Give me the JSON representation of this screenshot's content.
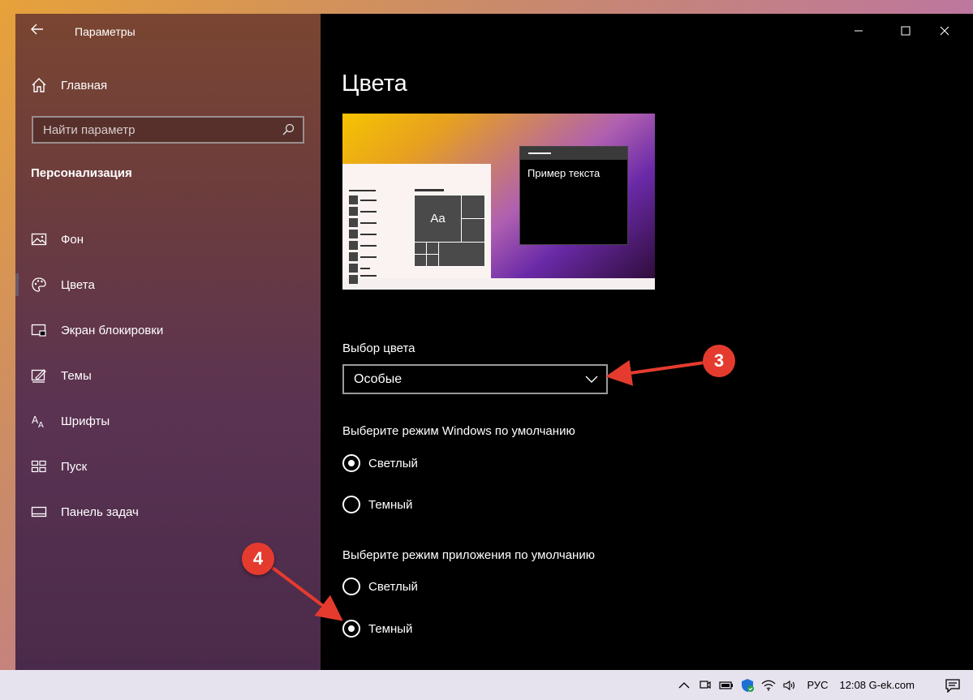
{
  "window": {
    "app_title": "Параметры",
    "controls": {
      "minimize": "minimize-icon",
      "maximize": "maximize-icon",
      "close": "close-icon"
    }
  },
  "sidebar": {
    "home_label": "Главная",
    "search_placeholder": "Найти параметр",
    "section_title": "Персонализация",
    "items": [
      {
        "label": "Фон",
        "icon": "picture-icon",
        "active": false
      },
      {
        "label": "Цвета",
        "icon": "palette-icon",
        "active": true
      },
      {
        "label": "Экран блокировки",
        "icon": "lock-screen-icon",
        "active": false
      },
      {
        "label": "Темы",
        "icon": "themes-icon",
        "active": false
      },
      {
        "label": "Шрифты",
        "icon": "fonts-icon",
        "active": false
      },
      {
        "label": "Пуск",
        "icon": "start-icon",
        "active": false
      },
      {
        "label": "Панель задач",
        "icon": "taskbar-icon",
        "active": false
      }
    ]
  },
  "main": {
    "page_title": "Цвета",
    "preview": {
      "sample_text": "Пример текста",
      "tile_text": "Aa"
    },
    "color_choice": {
      "label": "Выбор цвета",
      "value": "Особые"
    },
    "windows_mode": {
      "label": "Выберите режим Windows по умолчанию",
      "options": [
        {
          "label": "Светлый",
          "checked": true
        },
        {
          "label": "Темный",
          "checked": false
        }
      ]
    },
    "app_mode": {
      "label": "Выберите режим приложения по умолчанию",
      "options": [
        {
          "label": "Светлый",
          "checked": false
        },
        {
          "label": "Темный",
          "checked": true
        }
      ]
    }
  },
  "annotations": {
    "marker_3": "3",
    "marker_4": "4",
    "color": "#e53b2f"
  },
  "taskbar": {
    "language": "РУС",
    "clock": "12:08 G-ek.com"
  }
}
